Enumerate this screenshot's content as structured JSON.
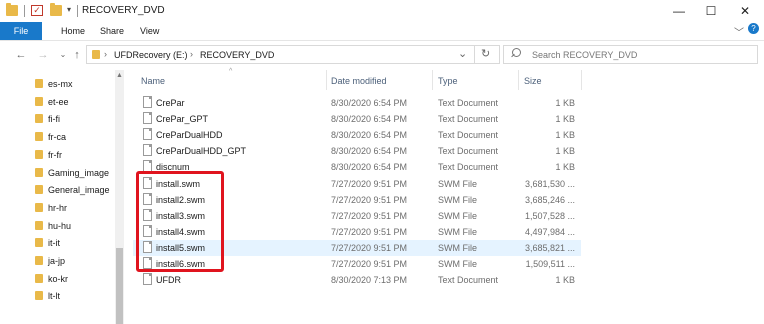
{
  "window": {
    "title": "RECOVERY_DVD",
    "minimize": "—",
    "maximize": "☐",
    "close": "✕"
  },
  "ribbon": {
    "tabs": [
      "File",
      "Home",
      "Share",
      "View"
    ],
    "expand": "﹀",
    "help": "?"
  },
  "address": {
    "crumbs": [
      "UFDRecovery (E:)",
      "RECOVERY_DVD"
    ],
    "separator": "›",
    "dropdown": "⌄",
    "refresh": "↻"
  },
  "search": {
    "placeholder": "Search RECOVERY_DVD"
  },
  "navpane": {
    "items": [
      "es-mx",
      "et-ee",
      "fi-fi",
      "fr-ca",
      "fr-fr",
      "Gaming_image",
      "General_image",
      "hr-hr",
      "hu-hu",
      "it-it",
      "ja-jp",
      "ko-kr",
      "lt-lt"
    ]
  },
  "columns": {
    "name": "Name",
    "date": "Date modified",
    "type": "Type",
    "size": "Size"
  },
  "files": [
    {
      "name": "CrePar",
      "date": "8/30/2020 6:54 PM",
      "type": "Text Document",
      "size": "1 KB"
    },
    {
      "name": "CrePar_GPT",
      "date": "8/30/2020 6:54 PM",
      "type": "Text Document",
      "size": "1 KB"
    },
    {
      "name": "CreParDualHDD",
      "date": "8/30/2020 6:54 PM",
      "type": "Text Document",
      "size": "1 KB"
    },
    {
      "name": "CreParDualHDD_GPT",
      "date": "8/30/2020 6:54 PM",
      "type": "Text Document",
      "size": "1 KB"
    },
    {
      "name": "discnum",
      "date": "8/30/2020 6:54 PM",
      "type": "Text Document",
      "size": "1 KB"
    },
    {
      "name": "install.swm",
      "date": "7/27/2020 9:51 PM",
      "type": "SWM File",
      "size": "3,681,530 ..."
    },
    {
      "name": "install2.swm",
      "date": "7/27/2020 9:51 PM",
      "type": "SWM File",
      "size": "3,685,246 ..."
    },
    {
      "name": "install3.swm",
      "date": "7/27/2020 9:51 PM",
      "type": "SWM File",
      "size": "1,507,528 ..."
    },
    {
      "name": "install4.swm",
      "date": "7/27/2020 9:51 PM",
      "type": "SWM File",
      "size": "4,497,984 ..."
    },
    {
      "name": "install5.swm",
      "date": "7/27/2020 9:51 PM",
      "type": "SWM File",
      "size": "3,685,821 ..."
    },
    {
      "name": "install6.swm",
      "date": "7/27/2020 9:51 PM",
      "type": "SWM File",
      "size": "1,509,511 ..."
    },
    {
      "name": "UFDR",
      "date": "8/30/2020 7:13 PM",
      "type": "Text Document",
      "size": "1 KB"
    }
  ],
  "highlight_color": "#e0141e",
  "accent_color": "#1979ca"
}
